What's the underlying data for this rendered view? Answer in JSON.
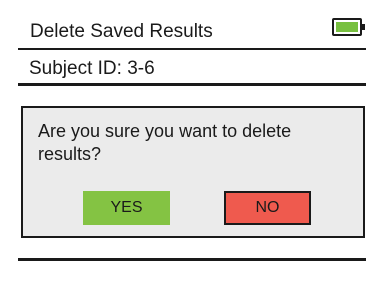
{
  "header": {
    "title": "Delete Saved Results",
    "battery_icon": "battery-full-icon",
    "battery_level": 1.0,
    "battery_color": "#78c040"
  },
  "subject": {
    "label": "Subject ID: 3-6"
  },
  "dialog": {
    "message": "Are you sure you want to delete results?",
    "yes_label": "YES",
    "no_label": "NO",
    "yes_color": "#84c343",
    "no_color": "#ef5a4e",
    "background_color": "#ebebeb"
  }
}
